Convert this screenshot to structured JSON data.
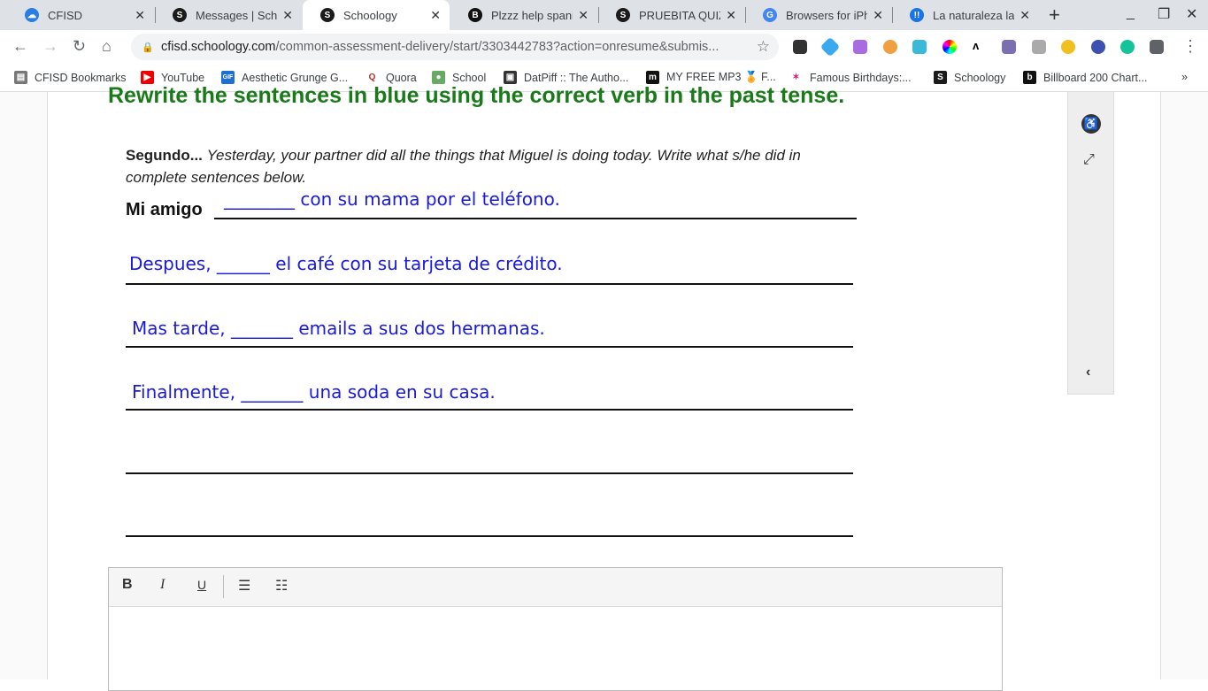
{
  "tabs": [
    {
      "title": "CFISD",
      "color": "#2a7de1",
      "glyph": "☁"
    },
    {
      "title": "Messages | Schoo",
      "color": "#1b1b1b",
      "glyph": "S"
    },
    {
      "title": "Schoology",
      "color": "#1b1b1b",
      "glyph": "S",
      "active": true
    },
    {
      "title": "Plzzz help spanis",
      "color": "#111",
      "glyph": "B"
    },
    {
      "title": "PRUEBITA QUIZ -",
      "color": "#1b1b1b",
      "glyph": "S"
    },
    {
      "title": "Browsers for iPho",
      "color": "#4285f4",
      "glyph": "G"
    },
    {
      "title": "La naturaleza la n",
      "color": "#1a73e8",
      "glyph": "!!"
    }
  ],
  "address": {
    "host": "cfisd.schoology.com",
    "path": "/common-assessment-delivery/start/3303442783?action=onresume&submis..."
  },
  "bookmarks": [
    {
      "label": "CFISD Bookmarks",
      "color": "#777",
      "glyph": "▤"
    },
    {
      "label": "YouTube",
      "color": "#e00",
      "glyph": "▶"
    },
    {
      "label": "Aesthetic Grunge G...",
      "color": "#1e6fd0",
      "glyph": "GIF"
    },
    {
      "label": "Quora",
      "color": "#fff",
      "glyph": "Q"
    },
    {
      "label": "School",
      "color": "#6a6",
      "glyph": "●"
    },
    {
      "label": "DatPiff :: The Autho...",
      "color": "#333",
      "glyph": "▣"
    },
    {
      "label": "MY FREE MP3 🏅 F...",
      "color": "#111",
      "glyph": "m"
    },
    {
      "label": "Famous Birthdays:...",
      "color": "#fff",
      "glyph": "✶"
    },
    {
      "label": "Schoology",
      "color": "#1b1b1b",
      "glyph": "S"
    },
    {
      "label": "Billboard 200 Chart...",
      "color": "#111",
      "glyph": "b"
    }
  ],
  "bookmarks_more": "»",
  "question": {
    "title": "Rewrite the sentences in blue using the correct verb in the past tense.",
    "instr_bold": "Segundo...",
    "instr_italic": "Yesterday, your partner did all the things that Miguel is doing today.  Write what s/he did in complete sentences below.",
    "lead": "Mi amigo",
    "sentences": [
      "________ con su mama por el teléfono.",
      "Despues, ______ el café con su tarjeta de crédito.",
      "Mas tarde, _______ emails a sus dos hermanas.",
      "Finalmente, _______ una soda en su casa."
    ]
  },
  "editor": {
    "bold": "B",
    "italic": "I",
    "underline": "U"
  }
}
